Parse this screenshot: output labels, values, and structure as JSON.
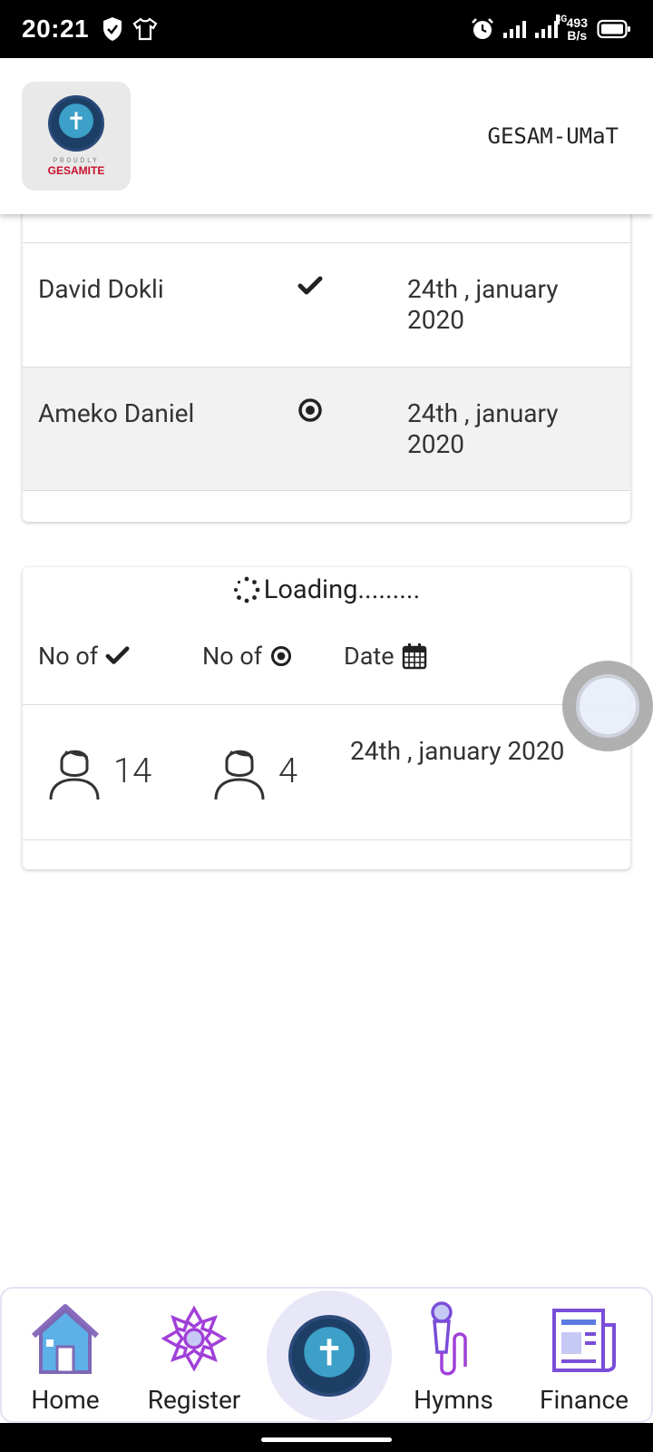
{
  "status_bar": {
    "time": "20:21",
    "net_speed_value": "493",
    "net_speed_unit": "B/s",
    "signal_tag": "3G"
  },
  "header": {
    "logo_tagline": "PROUDLY",
    "logo_name": "GESAMITE",
    "title": "GESAM-UMaT"
  },
  "attendance": {
    "rows": [
      {
        "name": "David Dokli",
        "mark": "check-icon",
        "date": "24th , january 2020"
      },
      {
        "name": "Ameko Daniel",
        "mark": "dot-circle-icon",
        "date": "24th , january 2020"
      }
    ]
  },
  "summary": {
    "loading_text": "Loading.........",
    "headers": {
      "present": "No of",
      "absent": "No of",
      "date": "Date"
    },
    "present_count": "14",
    "absent_count": "4",
    "date": "24th , january 2020"
  },
  "bottom_nav": {
    "items": [
      {
        "label": "Home",
        "icon": "home-icon"
      },
      {
        "label": "Register",
        "icon": "register-icon"
      },
      {
        "label": "",
        "icon": "gesam-logo"
      },
      {
        "label": "Hymns",
        "icon": "microphone-icon"
      },
      {
        "label": "Finance",
        "icon": "newspaper-icon"
      }
    ]
  },
  "colors": {
    "header_bg": "#ffffff",
    "status_bg": "#000000",
    "logo_red": "#c8102e",
    "nav_center_bg": "#e7e7f7",
    "row_alt_bg": "#f2f2f2"
  }
}
